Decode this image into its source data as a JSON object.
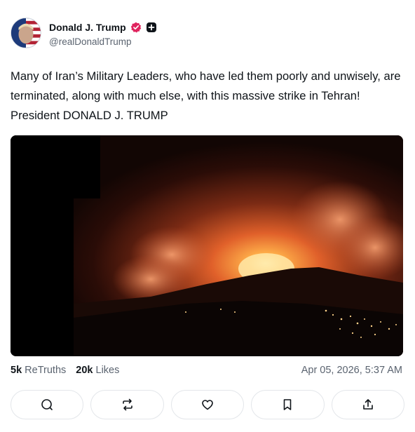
{
  "author": {
    "display_name": "Donald J. Trump",
    "handle": "@realDonaldTrump",
    "verified_badge_icon": "verified-badge-icon",
    "plus_badge_icon": "plus-badge-icon",
    "badge_color": "#e0245e"
  },
  "post": {
    "text": "Many of Iran’s Military Leaders, who have led them poorly and unwisely, are terminated, along with much else, with this massive strike in Tehran! President DONALD J. TRUMP"
  },
  "stats": {
    "retruths_count": "5k",
    "retruths_label": "ReTruths",
    "likes_count": "20k",
    "likes_label": "Likes",
    "timestamp": "Apr 05, 2026, 5:37 AM"
  },
  "actions": [
    {
      "icon": "reply-icon"
    },
    {
      "icon": "retruth-icon"
    },
    {
      "icon": "like-icon"
    },
    {
      "icon": "bookmark-icon"
    },
    {
      "icon": "share-icon"
    }
  ]
}
